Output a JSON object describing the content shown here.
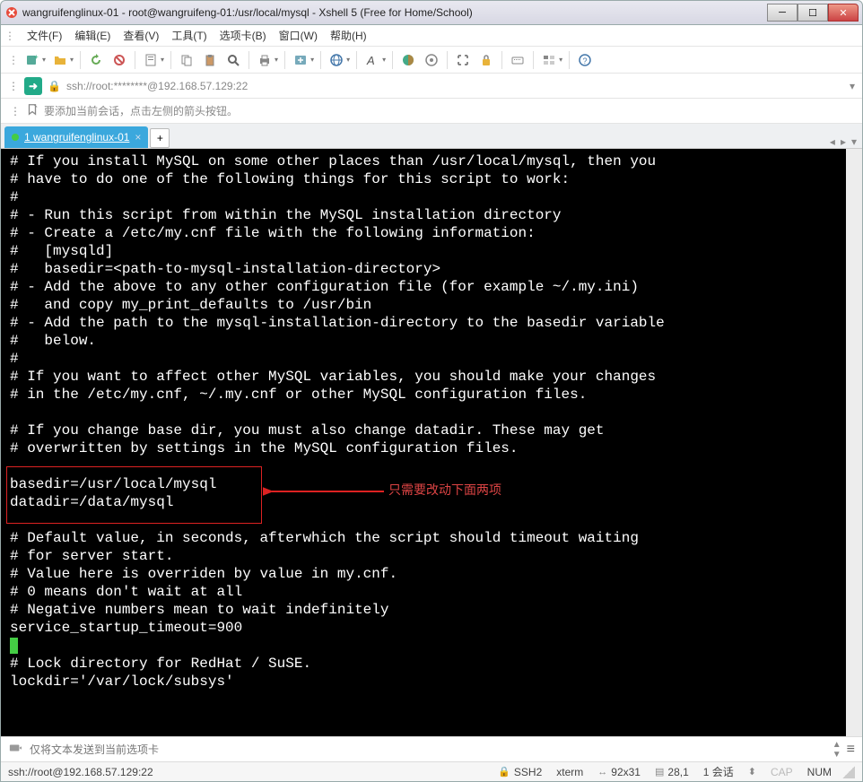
{
  "window": {
    "title": "wangruifenglinux-01 - root@wangruifeng-01:/usr/local/mysql - Xshell 5 (Free for Home/School)"
  },
  "menu": {
    "file": "文件(F)",
    "edit": "编辑(E)",
    "view": "查看(V)",
    "tools": "工具(T)",
    "tabs": "选项卡(B)",
    "window": "窗口(W)",
    "help": "帮助(H)"
  },
  "address": "ssh://root:********@192.168.57.129:22",
  "hint": "要添加当前会话，点击左侧的箭头按钮。",
  "tab": {
    "label": "1 wangruifenglinux-01"
  },
  "terminal": {
    "lines": [
      "# If you install MySQL on some other places than /usr/local/mysql, then you",
      "# have to do one of the following things for this script to work:",
      "#",
      "# - Run this script from within the MySQL installation directory",
      "# - Create a /etc/my.cnf file with the following information:",
      "#   [mysqld]",
      "#   basedir=<path-to-mysql-installation-directory>",
      "# - Add the above to any other configuration file (for example ~/.my.ini)",
      "#   and copy my_print_defaults to /usr/bin",
      "# - Add the path to the mysql-installation-directory to the basedir variable",
      "#   below.",
      "#",
      "# If you want to affect other MySQL variables, you should make your changes",
      "# in the /etc/my.cnf, ~/.my.cnf or other MySQL configuration files.",
      "",
      "# If you change base dir, you must also change datadir. These may get",
      "# overwritten by settings in the MySQL configuration files.",
      "",
      "basedir=/usr/local/mysql",
      "datadir=/data/mysql",
      "",
      "# Default value, in seconds, afterwhich the script should timeout waiting",
      "# for server start.",
      "# Value here is overriden by value in my.cnf.",
      "# 0 means don't wait at all",
      "# Negative numbers mean to wait indefinitely",
      "service_startup_timeout=900",
      "",
      "# Lock directory for RedHat / SuSE.",
      "lockdir='/var/lock/subsys'"
    ],
    "callout": "只需要改动下面两项"
  },
  "sendbar": {
    "placeholder": "仅将文本发送到当前选项卡"
  },
  "status": {
    "connection": "ssh://root@192.168.57.129:22",
    "proto": "SSH2",
    "term": "xterm",
    "size": "92x31",
    "pos": "28,1",
    "sessions": "1 会话",
    "cap": "CAP",
    "num": "NUM"
  }
}
